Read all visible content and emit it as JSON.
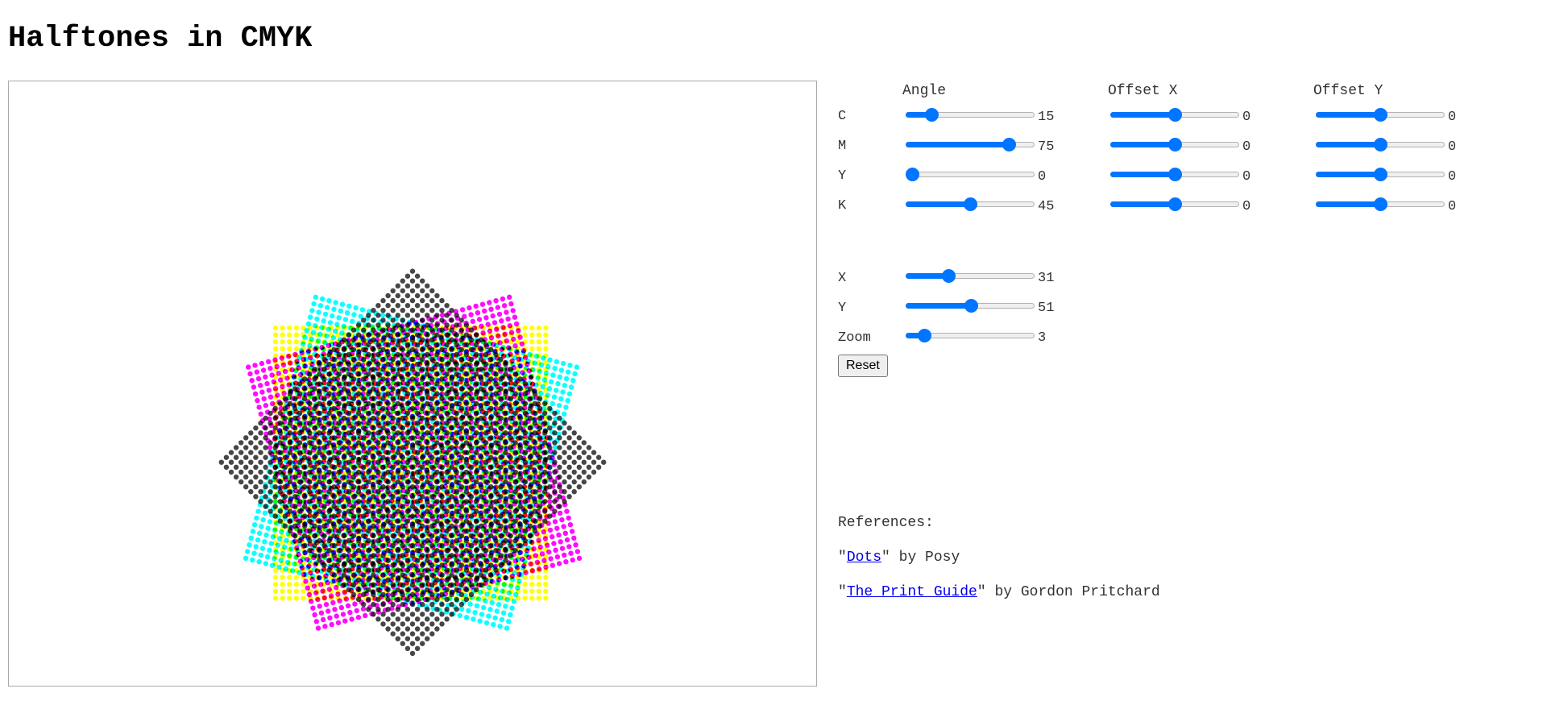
{
  "page": {
    "title": "Halftones in CMYK"
  },
  "channels": {
    "headers": {
      "angle": "Angle",
      "offset_x": "Offset X",
      "offset_y": "Offset Y"
    },
    "rows": [
      {
        "label": "C",
        "color": "#00ffff",
        "angle": {
          "value": "15",
          "min": 0,
          "max": 90
        },
        "offset_x": {
          "value": "0",
          "min": -10,
          "max": 10
        },
        "offset_y": {
          "value": "0",
          "min": -10,
          "max": 10
        }
      },
      {
        "label": "M",
        "color": "#ff00ff",
        "angle": {
          "value": "75",
          "min": 0,
          "max": 90
        },
        "offset_x": {
          "value": "0",
          "min": -10,
          "max": 10
        },
        "offset_y": {
          "value": "0",
          "min": -10,
          "max": 10
        }
      },
      {
        "label": "Y",
        "color": "#ffff00",
        "angle": {
          "value": "0",
          "min": 0,
          "max": 90
        },
        "offset_x": {
          "value": "0",
          "min": -10,
          "max": 10
        },
        "offset_y": {
          "value": "0",
          "min": -10,
          "max": 10
        }
      },
      {
        "label": "K",
        "color": "#333333",
        "angle": {
          "value": "45",
          "min": 0,
          "max": 90
        },
        "offset_x": {
          "value": "0",
          "min": -10,
          "max": 10
        },
        "offset_y": {
          "value": "0",
          "min": -10,
          "max": 10
        }
      }
    ]
  },
  "view": {
    "rows": [
      {
        "label": "X",
        "value": "31",
        "min": 0,
        "max": 100
      },
      {
        "label": "Y",
        "value": "51",
        "min": 0,
        "max": 100
      },
      {
        "label": "Zoom",
        "value": "3",
        "min": 1,
        "max": 20
      }
    ],
    "reset_label": "Reset"
  },
  "references": {
    "heading": "References:",
    "items": [
      {
        "quote_open": "\"",
        "link_text": "Dots",
        "quote_close": "\"",
        "suffix": " by Posy"
      },
      {
        "quote_open": "\"",
        "link_text": "The Print Guide",
        "quote_close": "\"",
        "suffix": " by Gordon Pritchard"
      }
    ]
  },
  "colors": {
    "accent": "#0075ff",
    "link": "#0000ee"
  }
}
